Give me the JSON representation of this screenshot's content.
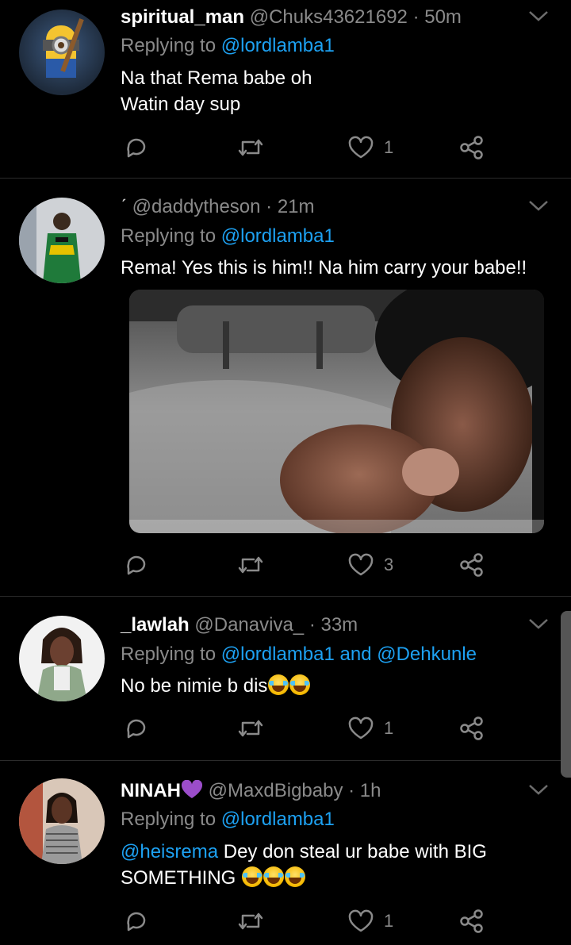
{
  "tweets": [
    {
      "name": "spiritual_man",
      "handle": "@Chuks43621692",
      "time": "· 50m",
      "replying_prefix": "Replying to ",
      "replying_to": "@lordlamba1",
      "lines": [
        "Na that Rema babe oh",
        "Watin day sup"
      ],
      "likes": "1"
    },
    {
      "name": "ˊ",
      "handle": "@daddytheson",
      "time": "· 21m",
      "replying_prefix": "Replying to ",
      "replying_to": "@lordlamba1",
      "lines": [
        "Rema! Yes this is him!! Na him carry your babe!!"
      ],
      "likes": "3"
    },
    {
      "name": "_lawlah",
      "handle": "@Danaviva_",
      "time": "· 33m",
      "replying_prefix": "Replying to ",
      "replying_to": "@lordlamba1 and @Dehkunle",
      "lines": [
        "No be nimie b dis"
      ],
      "likes": "1"
    },
    {
      "name": "NINAH",
      "handle": "@MaxdBigbaby",
      "time": "· 1h",
      "replying_prefix": "Replying to ",
      "replying_to": "@lordlamba1",
      "mention": "@heisrema",
      "lines": [
        " Dey don steal ur babe with BIG",
        "SOMETHING "
      ],
      "likes": "1"
    }
  ],
  "icons": {
    "reply": "reply-icon",
    "retweet": "retweet-icon",
    "like": "heart-icon",
    "share": "share-icon",
    "more": "chevron-down-icon"
  },
  "colors": {
    "background": "#000000",
    "link": "#1da1f2",
    "muted": "#8a8a8a",
    "purple_heart": "#9b4dca"
  }
}
